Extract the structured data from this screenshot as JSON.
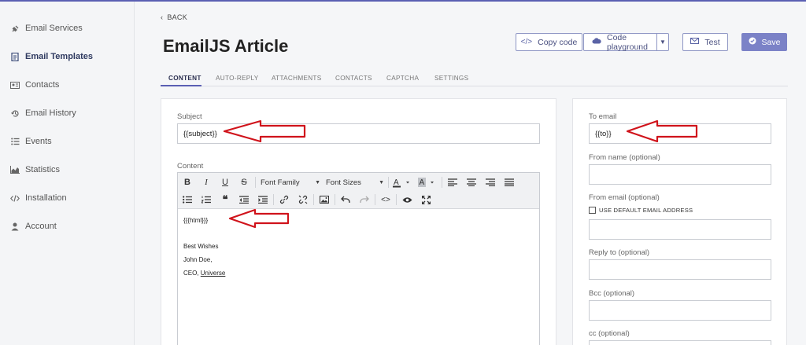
{
  "sidebar": {
    "items": [
      {
        "label": "Email Services",
        "icon": "plug-icon"
      },
      {
        "label": "Email Templates",
        "icon": "document-icon",
        "active": true
      },
      {
        "label": "Contacts",
        "icon": "contact-card-icon"
      },
      {
        "label": "Email History",
        "icon": "history-icon"
      },
      {
        "label": "Events",
        "icon": "list-icon"
      },
      {
        "label": "Statistics",
        "icon": "chart-icon"
      },
      {
        "label": "Installation",
        "icon": "code-icon"
      },
      {
        "label": "Account",
        "icon": "user-icon"
      }
    ]
  },
  "header": {
    "back_label": "BACK",
    "title": "EmailJS Article",
    "copy_code_label": "Copy code",
    "code_playground_label": "Code playground",
    "test_label": "Test",
    "save_label": "Save"
  },
  "tabs": [
    {
      "label": "CONTENT",
      "active": true
    },
    {
      "label": "AUTO-REPLY"
    },
    {
      "label": "ATTACHMENTS"
    },
    {
      "label": "CONTACTS"
    },
    {
      "label": "CAPTCHA"
    },
    {
      "label": "SETTINGS"
    }
  ],
  "form": {
    "subject_label": "Subject",
    "subject_value": "{{subject}}",
    "content_label": "Content",
    "toolbar": {
      "font_family": "Font Family",
      "font_sizes": "Font Sizes"
    },
    "content_lines": [
      "{{{html}}}",
      "Best Wishes",
      "John Doe,",
      "CEO, "
    ],
    "content_link": "Universe"
  },
  "right": {
    "to_email_label": "To email",
    "to_email_value": "{{to}}",
    "from_name_label": "From name (optional)",
    "from_name_value": "",
    "from_email_label": "From email (optional)",
    "use_default_label": "USE DEFAULT EMAIL ADDRESS",
    "from_email_value": "",
    "reply_to_label": "Reply to (optional)",
    "reply_to_value": "",
    "bcc_label": "Bcc (optional)",
    "bcc_value": "",
    "cc_label": "cc (optional)",
    "cc_value": ""
  },
  "colors": {
    "accent": "#5a5fb3",
    "save_button": "#7b82c7",
    "annotation_arrow": "#d0131b"
  }
}
